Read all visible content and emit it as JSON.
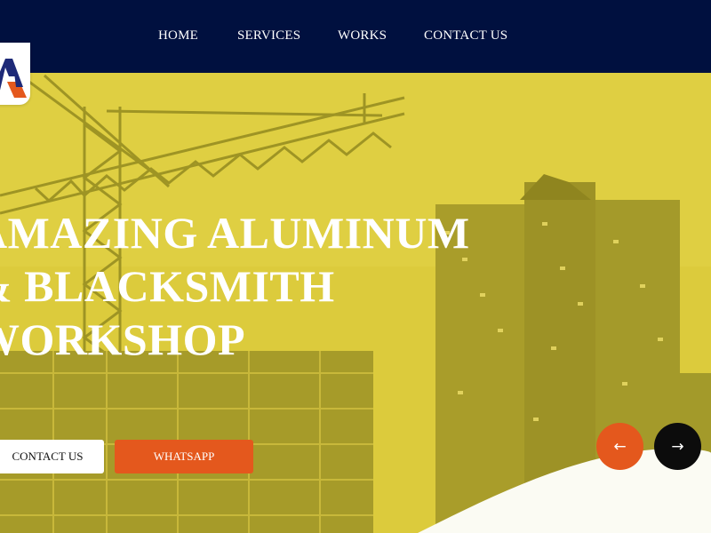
{
  "nav": {
    "items": [
      {
        "label": "HOME"
      },
      {
        "label": "SERVICES"
      },
      {
        "label": "WORKS"
      },
      {
        "label": "CONTACT US"
      }
    ]
  },
  "logo": {
    "icon": "logo-a-icon",
    "colors": [
      "#1e2a78",
      "#e4581d"
    ]
  },
  "hero": {
    "headline_lines": [
      "AMAZING ALUMINUM",
      "& BLACKSMITH",
      "WORKSHOP"
    ],
    "buttons": {
      "contact": "CONTACT US",
      "whatsapp": "WHATSAPP"
    },
    "slider": {
      "prev_icon": "arrow-left-icon",
      "next_icon": "arrow-right-icon"
    }
  },
  "colors": {
    "navbar": "#00103f",
    "overlay": "#d9c93a",
    "accent": "#e4581d",
    "dark_button": "#0c0c0c"
  }
}
